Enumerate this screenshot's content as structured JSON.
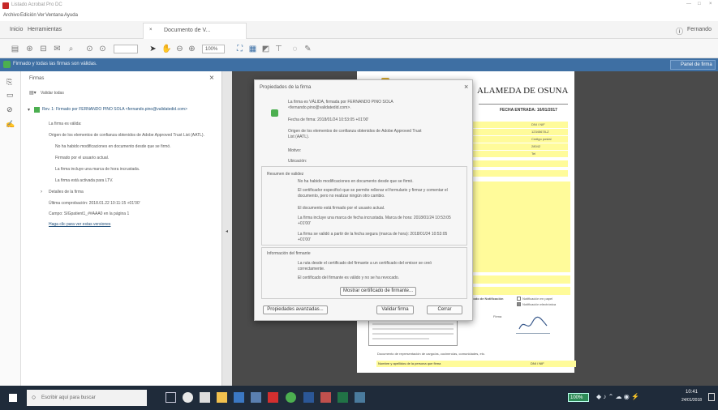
{
  "window": {
    "title": "Listado Acrobat Pro DC",
    "controls": [
      "—",
      "□",
      "×"
    ]
  },
  "menu": {
    "items": [
      "Archivo",
      "Edición",
      "Ver",
      "Ventana",
      "Ayuda"
    ]
  },
  "tabs": {
    "home": "Inicio",
    "tools": "Herramientas",
    "doc": "Documento de V...",
    "user": "Fernando"
  },
  "toolbar": {
    "zoom": "100%"
  },
  "sigbar": {
    "message": "Firmado y todas las firmas son válidas.",
    "panel_button": "Panel de firma"
  },
  "sig_panel": {
    "title": "Firmas",
    "validate_all": "Validar todas",
    "rev": "Rev. 1: Firmado por FERNANDO PINO SOLA <fernando.pino@validatedid.com>",
    "items": [
      "La firma es válida:",
      "Origen de los elementos de confianza obtenidos de Adobe Approved Trust List (AATL).",
      "No ha habido modificaciones en documento desde que se firmó.",
      "Firmado por el usuario actual.",
      "La firma incluye una marca de hora incrustada.",
      "La firma está activada para LTV.",
      "Detalles de la firma",
      "Última comprobación: 2018.01.22 10:11:15 +01'00'",
      "Campo: SIGpatient1_##AAA0 en la página 1",
      "Haga clic para ver estas versiones"
    ]
  },
  "document": {
    "heading": "ALAMEDA DE OSUNA",
    "date_label": "FECHA ENTRADA: 16/01/2017",
    "table_values": [
      "DNI / NIF",
      "12345678-Z",
      "Código postal",
      "28042",
      "Tel"
    ],
    "signature_label": "Firma",
    "notify_label": "Modo de Notificación",
    "notify_paper": "Notificación en papel",
    "notify_digital": "Notificación electrónica",
    "legal": "Documento de representación de cargo/as, cocinero/as, comunidades, etc.",
    "footer_label": "Nombre y apellidos de la persona que firma",
    "footer_value": "DNI / NIF"
  },
  "dialog": {
    "title": "Propiedades de la firma",
    "close": "×",
    "intro": "La firma es VÁLIDA, firmada por FERNANDO PINO SOLA <fernando.pino@validatedid.com>.",
    "sign_date": "Fecha de firma: 2018/01/24 10:53:05 +01'00'",
    "origin": "Origen de los elementos de confianza obtenidos de Adobe Approved Trust List (AATL).",
    "reason_label": "Motivo:",
    "location_label": "Ubicación:",
    "validity_title": "Resumen de validez",
    "validity_items": [
      "No ha habido modificaciones en documento desde que se firmó.",
      "El certificador especificó que se permite rellenar el formulario y firmar y comentar el documento, pero no realizar ningún otro cambio.",
      "El documento está firmado por el usuario actual.",
      "La firma incluye una marca de fecha incrustada. Marca de hora: 2018/01/24 10:53:05 +01'00'",
      "La firma se validó a partir de la fecha segura (marca de hora): 2018/01/24 10:53:05 +01'00'"
    ],
    "signer_title": "Información del firmante",
    "signer_items": [
      "La ruta desde el certificado del firmante a un certificado del emisor se creó correctamente.",
      "El certificado del firmante es válido y no se ha revocado."
    ],
    "show_cert": "Mostrar certificado de firmante...",
    "advanced": "Propiedades avanzadas...",
    "validate": "Validar firma",
    "close_btn": "Cerrar"
  },
  "taskbar": {
    "search": "Escribir aquí para buscar",
    "battery": "100%",
    "time": "10:41",
    "date": "24/01/2018"
  }
}
